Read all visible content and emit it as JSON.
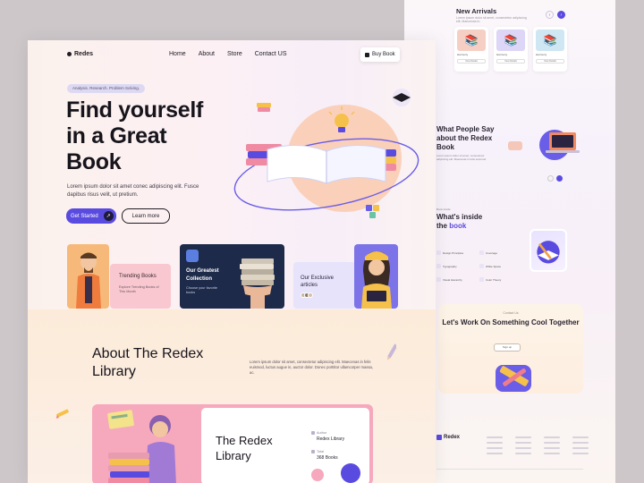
{
  "back_page": {
    "new_arrivals": {
      "title": "New Arrivals",
      "subtitle": "Lorem ipsum dolor sit amet, consectetur adipiscing elit. Maecenas in.",
      "prev_icon": "chevron-left-icon",
      "next_icon": "chevron-right-icon",
      "cards": [
        {
          "title": "Harmony",
          "button": "View Details",
          "color": "#f6cfc4"
        },
        {
          "title": "Harmony",
          "button": "View Details",
          "color": "#ddd6f7"
        },
        {
          "title": "Harmony",
          "button": "View Details",
          "color": "#cfe6f3"
        }
      ]
    },
    "testimonials": {
      "title": "What People Say about the Redex Book",
      "body": "Lorem ipsum dolor sit amet, consectetur adipiscing elit. Maecenas in felis euismod."
    },
    "inside": {
      "tag": "Book Inside",
      "title_main": "What's inside the ",
      "title_accent": "book",
      "features": [
        "Design Principles",
        "Coverage",
        "Typography",
        "White Space",
        "Visual Hierarchy",
        "Color Theory"
      ]
    },
    "cta": {
      "tag": "Contact Us",
      "title": "Let's Work On Something Cool Together",
      "button": "Sign up"
    },
    "footer": {
      "logo": "Redex"
    }
  },
  "front_page": {
    "nav": {
      "logo": "Redes",
      "links": [
        "Home",
        "About",
        "Store",
        "Contact US"
      ],
      "buy_button": "Buy Book",
      "buy_icon": "bag-icon"
    },
    "hero": {
      "tag": "Analysis. Research. Problem Solving.",
      "title": "Find yourself in a Great Book",
      "subtitle": "Lorem ipsum dolor sit amet conec adipiscing elit. Fusce dapibus risus velit, ut pretium.",
      "primary_button": "Get Started",
      "secondary_button": "Learn more"
    },
    "cards": {
      "trending": {
        "title": "Trending Books",
        "subtitle": "Explore Trending Books of This Month"
      },
      "collection": {
        "title": "Our Greatest Collection",
        "subtitle": "Choose your favorite books"
      },
      "exclusive": {
        "title": "Our Exclusive articles"
      }
    },
    "about": {
      "title": "About The Redex Library",
      "description": "Lorem ipsum dolor sit amet, consectetur adipiscing elit. Maecenas in felis euismod, luctus augue in, auctor dolor. Donec porttitor ullamcorper massa, ac.",
      "library_card": {
        "title": "The Redex Library",
        "author_label": "Author",
        "author_value": "Redex Library",
        "total_label": "Total",
        "total_value": "368 Books"
      }
    },
    "colors": {
      "accent": "#5a4be0",
      "dark": "#17141c"
    }
  }
}
